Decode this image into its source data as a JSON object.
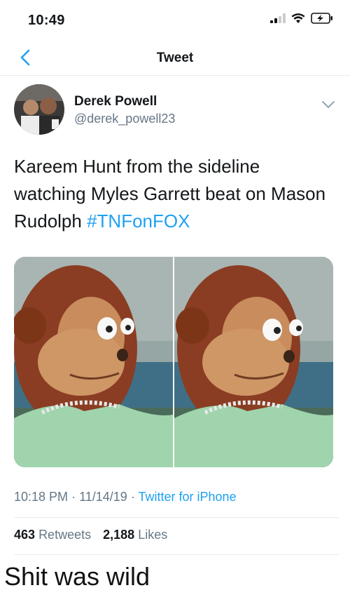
{
  "status_bar": {
    "time": "10:49",
    "icons": [
      "cellular-signal-icon",
      "wifi-icon",
      "battery-charging-icon"
    ]
  },
  "nav": {
    "title": "Tweet",
    "back_icon": "chevron-left-icon"
  },
  "author": {
    "display_name": "Derek Powell",
    "handle": "@derek_powell23"
  },
  "tweet": {
    "text": "Kareem Hunt from the sideline watching Myles Garrett beat on Mason Rudolph ",
    "hashtag": "#TNFonFOX",
    "media": [
      "puppet-image-left",
      "puppet-image-right"
    ]
  },
  "meta": {
    "time": "10:18 PM",
    "separator": "·",
    "date": "11/14/19",
    "source": "Twitter for iPhone"
  },
  "stats": {
    "retweets_count": "463",
    "retweets_label": "Retweets",
    "likes_count": "2,188",
    "likes_label": "Likes"
  },
  "caption": "Shit was wild",
  "colors": {
    "accent": "#1da1f2",
    "secondary_text": "#657786",
    "divider": "#e6ecf0"
  }
}
